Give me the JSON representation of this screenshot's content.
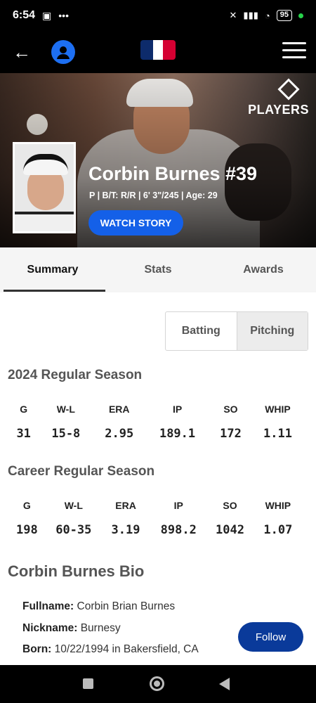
{
  "status_bar": {
    "time": "6:54",
    "battery": "95",
    "left_icons": [
      "photo-icon",
      "more-icon"
    ],
    "right_icons": [
      "mute-icon",
      "signal-icon",
      "wifi-icon"
    ]
  },
  "nav": {
    "back_icon": "arrow-left-icon",
    "profile_icon": "user-circle-icon",
    "logo": "mlb-logo",
    "menu_icon": "hamburger-menu-icon"
  },
  "hero": {
    "players_logo": "PLAYERS",
    "player_name": "Corbin Burnes #39",
    "meta": "P | B/T: R/R | 6' 3\"/245 | Age: 29",
    "watch_button": "WATCH STORY"
  },
  "tabs": [
    {
      "label": "Summary",
      "active": true
    },
    {
      "label": "Stats",
      "active": false
    },
    {
      "label": "Awards",
      "active": false
    }
  ],
  "toggle": {
    "batting": "Batting",
    "pitching": "Pitching",
    "selected": "Pitching"
  },
  "season": {
    "title": "2024 Regular Season",
    "headers": [
      "G",
      "W-L",
      "ERA",
      "IP",
      "SO",
      "WHIP"
    ],
    "values": [
      "31",
      "15-8",
      "2.95",
      "189.1",
      "172",
      "1.11"
    ]
  },
  "career": {
    "title": "Career Regular Season",
    "headers": [
      "G",
      "W-L",
      "ERA",
      "IP",
      "SO",
      "WHIP"
    ],
    "values": [
      "198",
      "60-35",
      "3.19",
      "898.2",
      "1042",
      "1.07"
    ]
  },
  "bio": {
    "title": "Corbin Burnes Bio",
    "fullname_label": "Fullname:",
    "fullname": "Corbin Brian Burnes",
    "nickname_label": "Nickname:",
    "nickname": "Burnesy",
    "born_label": "Born:",
    "born": "10/22/1994 in Bakersfield, CA",
    "follow_button": "Follow"
  }
}
